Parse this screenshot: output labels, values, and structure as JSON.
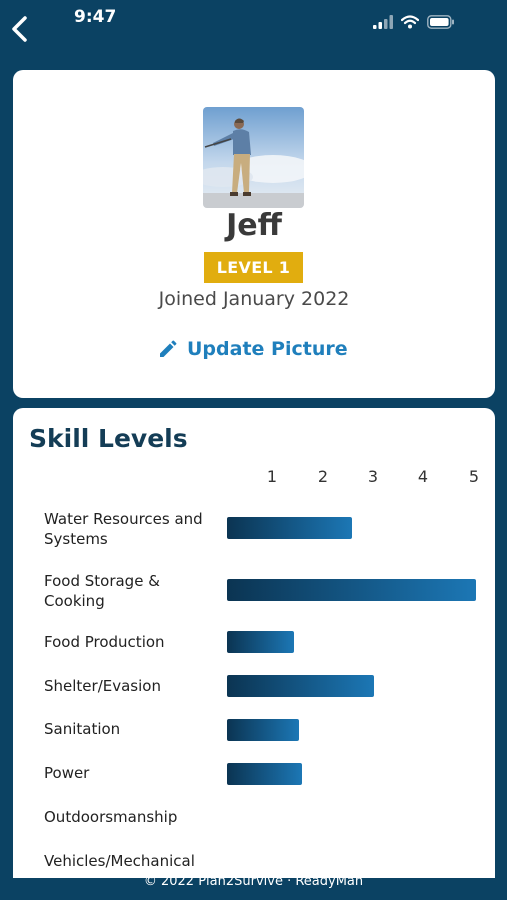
{
  "status_bar": {
    "time": "9:47"
  },
  "profile": {
    "name": "Jeff",
    "level_badge": "LEVEL 1",
    "joined": "Joined January 2022",
    "update_picture_label": "Update Picture"
  },
  "skills": {
    "title": "Skill Levels",
    "scale": [
      "1",
      "2",
      "3",
      "4",
      "5"
    ],
    "items": [
      {
        "label": "Water Resources and Systems",
        "level": 2.5
      },
      {
        "label": "Food Storage & Cooking",
        "level": 5.0
      },
      {
        "label": "Food Production",
        "level": 1.35
      },
      {
        "label": "Shelter/Evasion",
        "level": 2.95
      },
      {
        "label": "Sanitation",
        "level": 1.45
      },
      {
        "label": "Power",
        "level": 1.5
      },
      {
        "label": "Outdoorsmanship",
        "level": 0
      },
      {
        "label": "Vehicles/Mechanical",
        "level": 0
      }
    ]
  },
  "footer": {
    "text": "© 2022 Plan2Survive · ReadyMan"
  },
  "colors": {
    "header_bg": "#0b4263",
    "badge": "#e1ad0f",
    "link": "#1f7fbc",
    "bar_start": "#0b3452",
    "bar_end": "#1c77b5"
  },
  "icons": {
    "back": "chevron-left-icon",
    "signal": "signal-icon",
    "wifi": "wifi-icon",
    "battery": "battery-icon",
    "edit": "pencil-icon"
  }
}
